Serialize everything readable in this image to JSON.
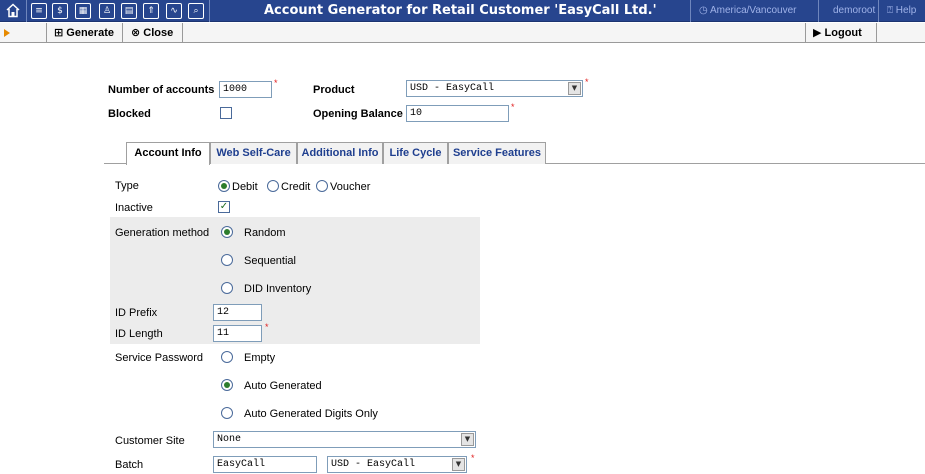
{
  "header": {
    "title": "Account Generator for Retail Customer 'EasyCall Ltd.'",
    "timezone": "America/Vancouver",
    "user": "demoroot",
    "help": "Help",
    "nav_icons": [
      "home-icon",
      "list-icon",
      "dollar-icon",
      "grid-icon",
      "person-icon",
      "calendar-icon",
      "upload-icon",
      "chart-icon",
      "search-icon"
    ]
  },
  "toolbar": {
    "generate_label": "Generate",
    "close_label": "Close",
    "logout_label": "Logout"
  },
  "top_form": {
    "num_accounts_label": "Number of accounts",
    "num_accounts_value": "1000",
    "product_label": "Product",
    "product_value": "USD - EasyCall",
    "blocked_label": "Blocked",
    "blocked_checked": false,
    "opening_balance_label": "Opening Balance",
    "opening_balance_value": "10"
  },
  "tabs": [
    "Account Info",
    "Web Self-Care",
    "Additional Info",
    "Life Cycle",
    "Service Features"
  ],
  "account_info": {
    "type_label": "Type",
    "type_options": [
      "Debit",
      "Credit",
      "Voucher"
    ],
    "type_selected": "Debit",
    "inactive_label": "Inactive",
    "inactive_checked": true,
    "gen_method_label": "Generation method",
    "gen_method_options": [
      "Random",
      "Sequential",
      "DID Inventory"
    ],
    "gen_method_selected": "Random",
    "id_prefix_label": "ID Prefix",
    "id_prefix_value": "12",
    "id_length_label": "ID Length",
    "id_length_value": "11",
    "service_password_label": "Service Password",
    "service_password_options": [
      "Empty",
      "Auto Generated",
      "Auto Generated Digits Only"
    ],
    "service_password_selected": "Auto Generated",
    "customer_site_label": "Customer Site",
    "customer_site_value": "None",
    "batch_label": "Batch",
    "batch_value": "EasyCall",
    "batch_product_value": "USD - EasyCall"
  },
  "colors": {
    "header_bg": "#27458e",
    "tab_text": "#1f3f8f",
    "required": "#e02020"
  }
}
